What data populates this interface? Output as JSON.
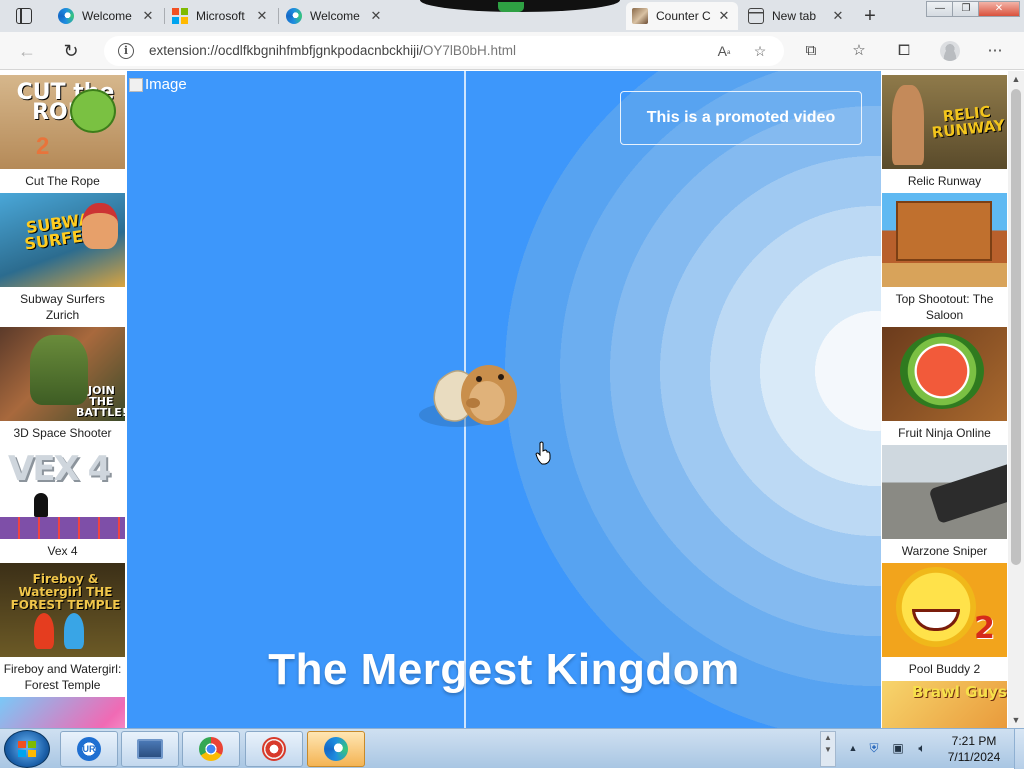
{
  "browser": {
    "tabs": [
      {
        "label": "Welcome",
        "favicon": "edge-icon",
        "active": false
      },
      {
        "label": "Microsoft",
        "favicon": "microsoft-icon",
        "active": false
      },
      {
        "label": "Welcome",
        "favicon": "edge-icon",
        "active": false
      },
      {
        "label": "Counter C",
        "favicon": "counter-icon",
        "active": true
      },
      {
        "label": "New tab",
        "favicon": "newtab-icon",
        "active": false
      }
    ],
    "new_tab_symbol": "+",
    "window_buttons": {
      "minimize": "—",
      "maximize": "❐",
      "close": "✕"
    },
    "address": {
      "scheme_host": "extension://ocdlfkbgnihfmbfjgnkpodacnbckhiji/",
      "path": "OY7lB0bH.html"
    }
  },
  "sidebar_left": [
    {
      "title": "Cut The Rope",
      "thumb_text": "CUT the ROPE",
      "thumb_num": "2"
    },
    {
      "title": "Subway Surfers Zurich",
      "thumb_text": "SUBWAY SURFERS"
    },
    {
      "title": "3D Space Shooter",
      "thumb_text": "JOIN THE BATTLE!"
    },
    {
      "title": "Vex 4",
      "thumb_text": "VEX 4"
    },
    {
      "title": "Fireboy and Watergirl: Forest Temple",
      "thumb_text": "Fireboy & Watergirl THE FOREST TEMPLE"
    },
    {
      "title": ""
    }
  ],
  "sidebar_right": [
    {
      "title": "Relic Runway",
      "thumb_text": "RELIC RUNWAY"
    },
    {
      "title": "Top Shootout: The Saloon"
    },
    {
      "title": "Fruit Ninja Online"
    },
    {
      "title": "Warzone Sniper"
    },
    {
      "title": "Pool Buddy 2",
      "thumb_text": "2"
    },
    {
      "title": "",
      "thumb_text": "Brawl Guys"
    }
  ],
  "game": {
    "broken_image_alt": "Image",
    "promo": "This is a promoted video",
    "title": "The Mergest Kingdom"
  },
  "taskbar": {
    "clock_time": "7:21 PM",
    "clock_date": "7/11/2024",
    "ur_label": "UR"
  },
  "colors": {
    "game_blue": "#3d97fb",
    "tab_strip": "#dfe3e8",
    "taskbar": "#a9c6e3"
  }
}
